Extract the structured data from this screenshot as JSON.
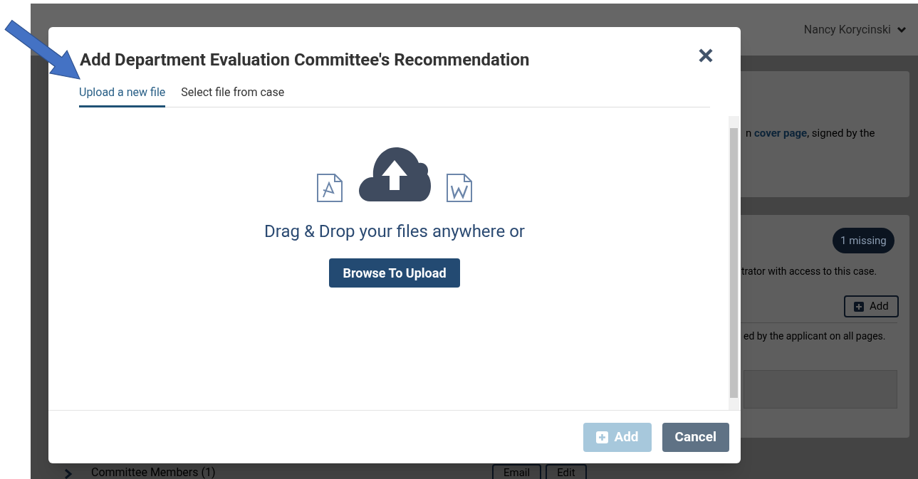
{
  "header": {
    "user_name": "Nancy Korycinski"
  },
  "background": {
    "card_1_text_before": "n",
    "card_1_link": "cover page",
    "card_1_text_after": ", signed by the",
    "badge": "1 missing",
    "card_2_text_1": "trator with access to this case.",
    "add_button": "Add",
    "card_2_text_2": "ed by the applicant on all pages.",
    "section_title": "Committee Members (1)",
    "section_buttons": [
      "Email",
      "Edit"
    ]
  },
  "modal": {
    "title": "Add Department Evaluation Committee's Recommendation",
    "tabs": [
      {
        "label": "Upload a new file",
        "selected": true
      },
      {
        "label": "Select file from case",
        "selected": false
      }
    ],
    "drop_text": "Drag & Drop your files anywhere or",
    "browse_button": "Browse To Upload",
    "buttons": [
      {
        "label": "Add",
        "kind": "primary",
        "disabled": true
      },
      {
        "label": "Cancel",
        "kind": "secondary",
        "disabled": false
      }
    ]
  }
}
